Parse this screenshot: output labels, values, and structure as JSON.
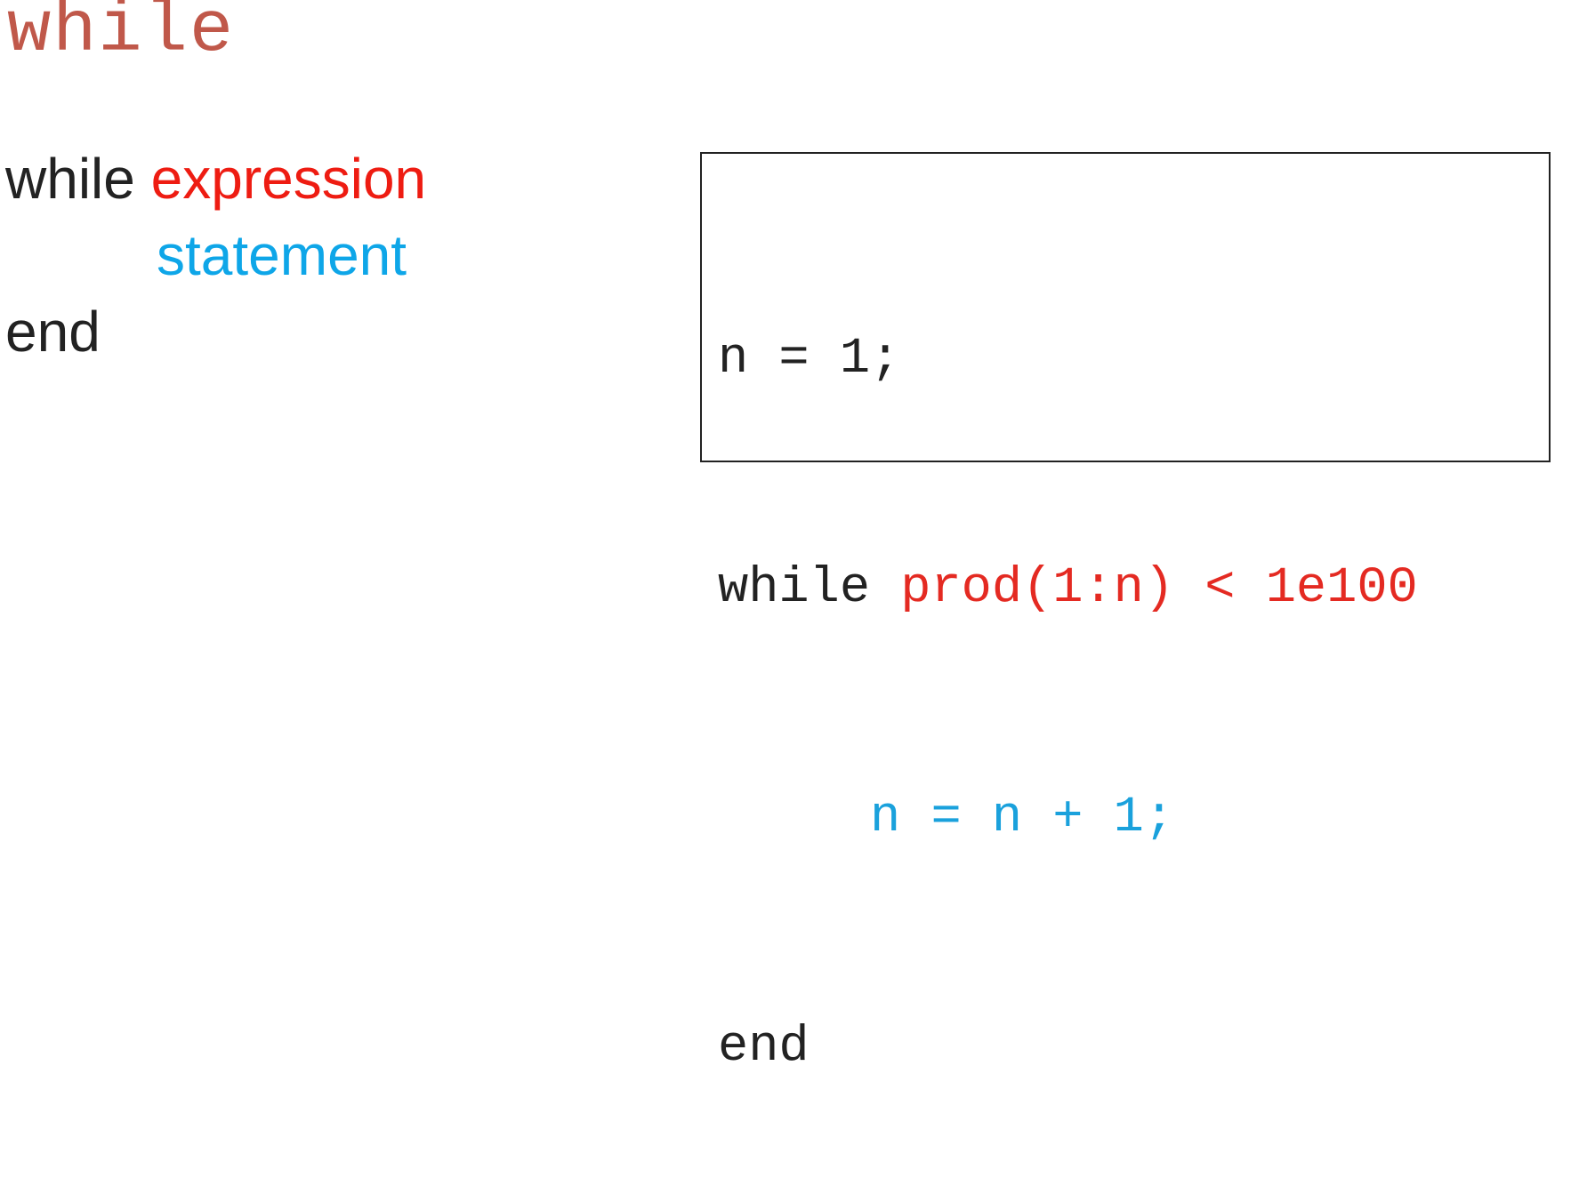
{
  "title": "while",
  "syntax": {
    "line1_keyword": "while",
    "line1_expression": "expression",
    "line2_statement": "statement",
    "line3_end": "end"
  },
  "code": {
    "line1": "n = 1;",
    "line2_keyword": "while ",
    "line2_condition": "prod(1:n) < 1e100",
    "line3_indent": "     ",
    "line3_statement": "n = n + 1;",
    "line4_end": "end"
  },
  "colors": {
    "title": "#c0584a",
    "expression": "#ee1c12",
    "statement": "#0ea6e8",
    "text": "#222222"
  }
}
